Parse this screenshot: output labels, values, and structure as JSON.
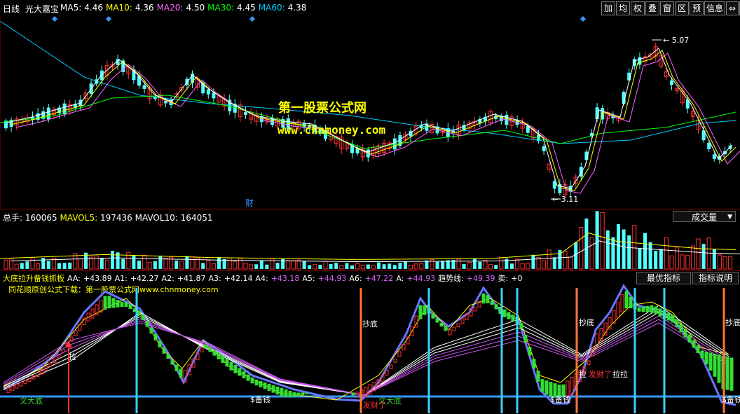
{
  "main": {
    "period": "日线",
    "stock": "光大嘉宝",
    "ma": [
      {
        "label": "MA5:",
        "value": "4.46",
        "color": "#ffffff"
      },
      {
        "label": "MA10:",
        "value": "4.36",
        "color": "#ffff00"
      },
      {
        "label": "MA20:",
        "value": "4.50",
        "color": "#ff66ff"
      },
      {
        "label": "MA30:",
        "value": "4.45",
        "color": "#00ff00"
      },
      {
        "label": "MA60:",
        "value": "4.38",
        "color": "#00ccff"
      }
    ],
    "high_label": "5.07",
    "low_label": "3.11",
    "finance_marker": "财",
    "watermark_name": "第一股票公式网",
    "watermark_url": "www.chnmoney.com"
  },
  "toolbar": {
    "buttons": [
      "加",
      "均",
      "权",
      "叠",
      "窗",
      "区",
      "预",
      "信息"
    ],
    "icon_buttons": [
      "left-right-arrow-icon",
      "close-window-icon"
    ]
  },
  "volume": {
    "total_label": "总手:",
    "total_value": "160065",
    "mavol5_label": "MAVOL5:",
    "mavol5_value": "197436",
    "mavol10_label": "MAVOL10:",
    "mavol10_value": "164051",
    "select_value": "成交量"
  },
  "indicator": {
    "name": "大底拉升备钱抓板",
    "values": [
      {
        "label": "AA:",
        "value": "+43.89",
        "color": "#ffffff"
      },
      {
        "label": "A1:",
        "value": "+42.27",
        "color": "#ffffff"
      },
      {
        "label": "A2:",
        "value": "+41.87",
        "color": "#ffffff"
      },
      {
        "label": "A3:",
        "value": "+42.14",
        "color": "#ffffff"
      },
      {
        "label": "A4:",
        "value": "+43.18",
        "color": "#dd66ff"
      },
      {
        "label": "A5:",
        "value": "+44.93",
        "color": "#dd66ff"
      },
      {
        "label": "A6:",
        "value": "+47.22",
        "color": "#dd66ff"
      },
      {
        "label": "A:",
        "value": "+44.93",
        "color": "#dd66ff"
      },
      {
        "label": "趋势线:",
        "value": "+49.39",
        "color": "#dd66ff"
      },
      {
        "label": "卖:",
        "value": "+0",
        "color": "#ffffff"
      }
    ],
    "btn_best": "最优指标",
    "btn_help": "指标说明",
    "source_text": "同花顺原创公式下载：第一股票公式网www.chnmoney.com",
    "signal_chaodi": "抄底",
    "signal_la": "拉",
    "signal_lala": "拉拉",
    "signal_wenda": "文大底",
    "signal_beiqian": "$备钱",
    "signal_fa": "发财了"
  },
  "colors": {
    "up": "#ff3232",
    "down": "#54ffff",
    "border": "#800000",
    "label": "#ffff00"
  }
}
